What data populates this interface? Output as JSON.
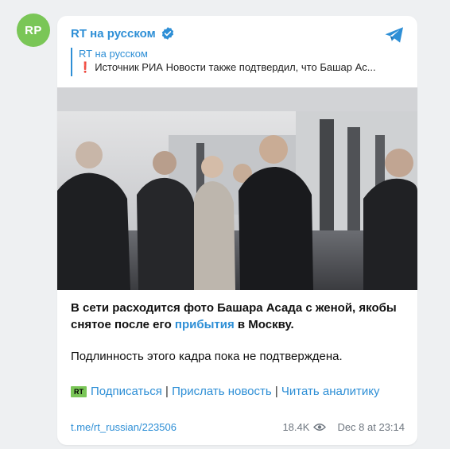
{
  "avatar": {
    "initials": "RP",
    "color": "#7ac657"
  },
  "channel": {
    "name": "RT на русском",
    "verified_icon": "verified-badge-icon"
  },
  "reply": {
    "author": "RT на русском",
    "icon": "❗",
    "text": "Источник РИА Новости также подтвердил, что Башар Ас..."
  },
  "photo": {
    "description_icon": "photo"
  },
  "post": {
    "p1_before": "В сети расходится фото Башара Асада с женой, якобы снятое после его ",
    "p1_link": "прибытия",
    "p1_after": " в Москву.",
    "p2": "Подлинность этого кадра пока не подтверждена."
  },
  "links": {
    "badge": "RT",
    "subscribe": "Подписаться",
    "sep1": " | ",
    "send_news": "Прислать новость",
    "sep2": " | ",
    "read_analytics": "Читать аналитику"
  },
  "footer": {
    "url": "t.me/rt_russian/223506",
    "views": "18.4K",
    "date": "Dec 8 at 23:14"
  },
  "colors": {
    "accent": "#2e8fd6",
    "brand_green": "#7ac657",
    "background": "#eef0f2"
  }
}
